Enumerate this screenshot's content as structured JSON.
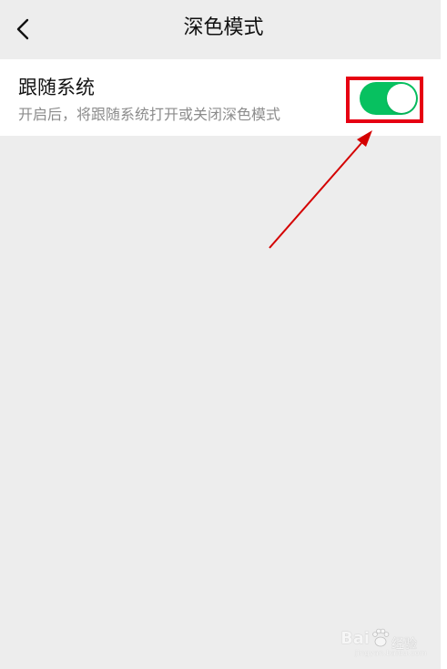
{
  "header": {
    "title": "深色模式",
    "back_icon": "chevron-left-icon"
  },
  "settings": {
    "follow_system": {
      "title": "跟随系统",
      "description": "开启后，将跟随系统打开或关闭深色模式",
      "enabled": true
    }
  },
  "annotation": {
    "highlight_color": "#e60012",
    "arrow_color": "#d40000"
  },
  "colors": {
    "background": "#ededed",
    "row_background": "#ffffff",
    "toggle_on": "#07c160",
    "title_text": "#111111",
    "desc_text": "#8c8c8c"
  },
  "watermark": {
    "brand_left": "Bai",
    "brand_right": "经验",
    "url": "jingyan.baidu.com"
  }
}
